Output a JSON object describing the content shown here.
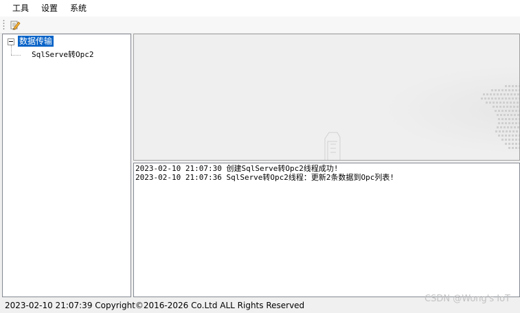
{
  "menubar": {
    "items": [
      "工具",
      "设置",
      "系统"
    ]
  },
  "toolbar": {
    "buttons": [
      {
        "icon": "edit-icon"
      }
    ]
  },
  "tree": {
    "root_label": "数据传输",
    "children": [
      "SqlServe转Opc2"
    ],
    "selected_color": "#0a64c8"
  },
  "log": {
    "lines": [
      "2023-02-10 21:07:30 创建SqlServe转Opc2线程成功!",
      "2023-02-10 21:07:36 SqlServe转Opc2线程：更新2条数据到Opc列表!"
    ]
  },
  "statusbar": {
    "text": "2023-02-10 21:07:39  Copyright©2016-2026  Co.Ltd ALL Rights Reserved"
  },
  "watermark": {
    "text": "CSDN @Wong's IoT"
  }
}
